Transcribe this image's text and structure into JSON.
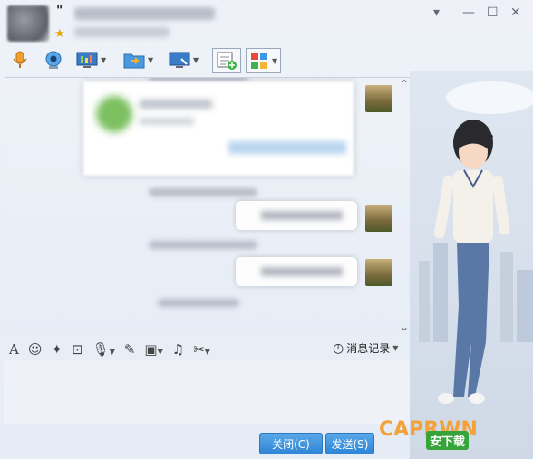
{
  "window": {
    "controls": {
      "dropdown": "▾",
      "minimize": "—",
      "maximize": "☐",
      "close": "✕"
    }
  },
  "contact": {
    "quote_mark": "\""
  },
  "toolbar": {
    "icons": [
      "microphone-icon",
      "video-icon",
      "screen-share-icon",
      "file-transfer-icon",
      "remote-desktop-icon",
      "add-note-icon",
      "apps-grid-icon"
    ]
  },
  "input_toolbar": {
    "history_label": "消息记录",
    "icons": [
      "font-icon",
      "emoji-icon",
      "magic-icon",
      "screenshot-icon",
      "voice-icon",
      "edit-icon",
      "image-icon",
      "music-icon",
      "scissors-icon"
    ]
  },
  "buttons": {
    "close": "关闭(C)",
    "send": "发送(S)"
  },
  "watermark": {
    "main": "CAPRWN",
    "sub": "安下载"
  },
  "colors": {
    "accent": "#2e86d6",
    "watermark_orange": "#f3a23a",
    "watermark_green": "#36a43a"
  }
}
